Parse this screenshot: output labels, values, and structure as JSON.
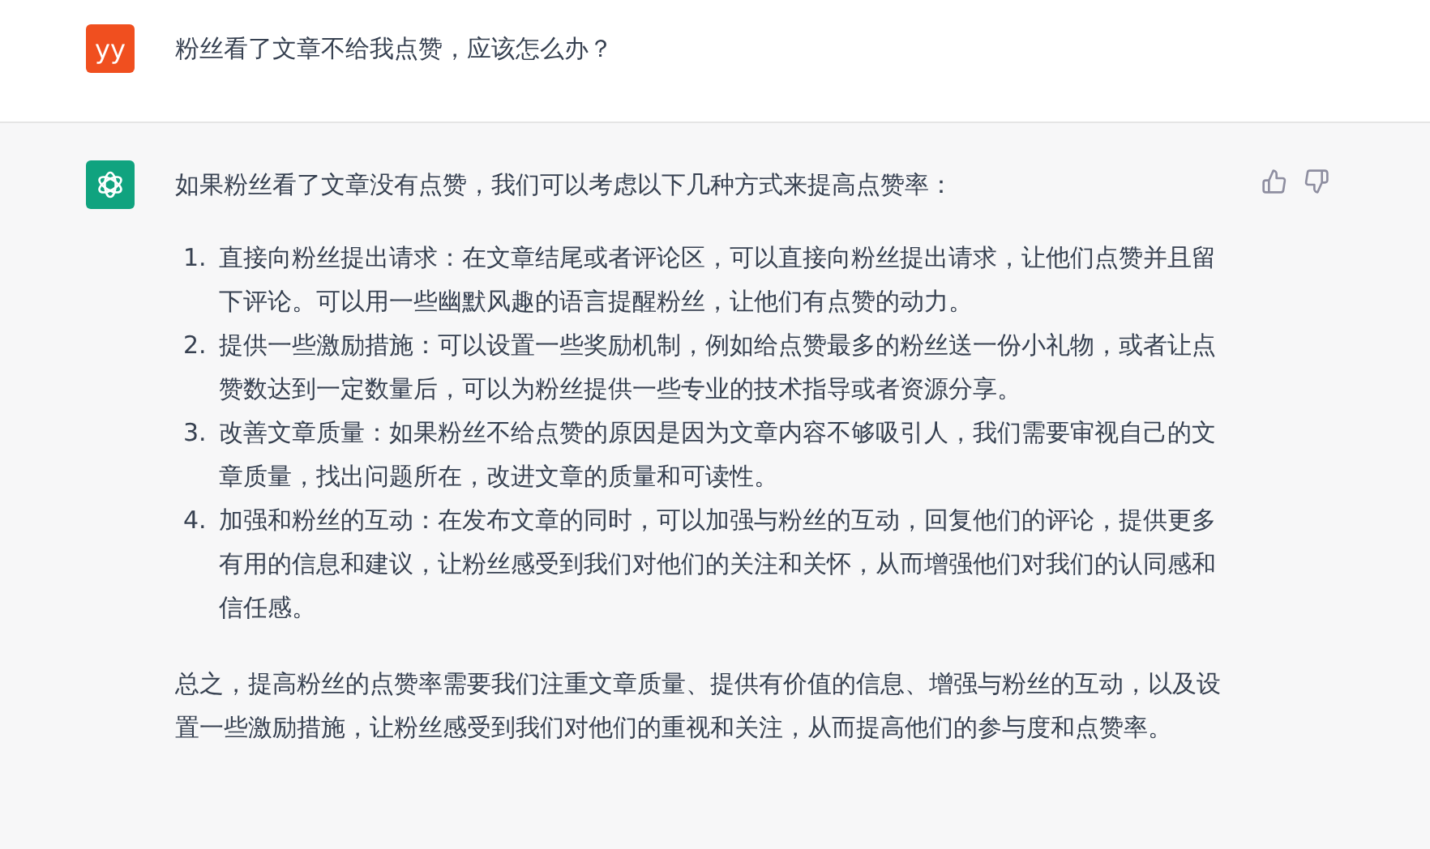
{
  "messages": [
    {
      "kind": "user",
      "avatar": "yy",
      "text": "粉丝看了文章不给我点赞，应该怎么办？"
    },
    {
      "kind": "assistant",
      "intro": "如果粉丝看了文章没有点赞，我们可以考虑以下几种方式来提高点赞率：",
      "list": [
        {
          "number": "1.",
          "text": "直接向粉丝提出请求：在文章结尾或者评论区，可以直接向粉丝提出请求，让他们点赞并且留下评论。可以用一些幽默风趣的语言提醒粉丝，让他们有点赞的动力。"
        },
        {
          "number": "2.",
          "text": "提供一些激励措施：可以设置一些奖励机制，例如给点赞最多的粉丝送一份小礼物，或者让点赞数达到一定数量后，可以为粉丝提供一些专业的技术指导或者资源分享。"
        },
        {
          "number": "3.",
          "text": "改善文章质量：如果粉丝不给点赞的原因是因为文章内容不够吸引人，我们需要审视自己的文章质量，找出问题所在，改进文章的质量和可读性。"
        },
        {
          "number": "4.",
          "text": "加强和粉丝的互动：在发布文章的同时，可以加强与粉丝的互动，回复他们的评论，提供更多有用的信息和建议，让粉丝感受到我们对他们的关注和关怀，从而增强他们对我们的认同感和信任感。"
        }
      ],
      "summary": "总之，提高粉丝的点赞率需要我们注重文章质量、提供有价值的信息、增强与粉丝的互动，以及设置一些激励措施，让粉丝感受到我们对他们的重视和关注，从而提高他们的参与度和点赞率。"
    }
  ]
}
